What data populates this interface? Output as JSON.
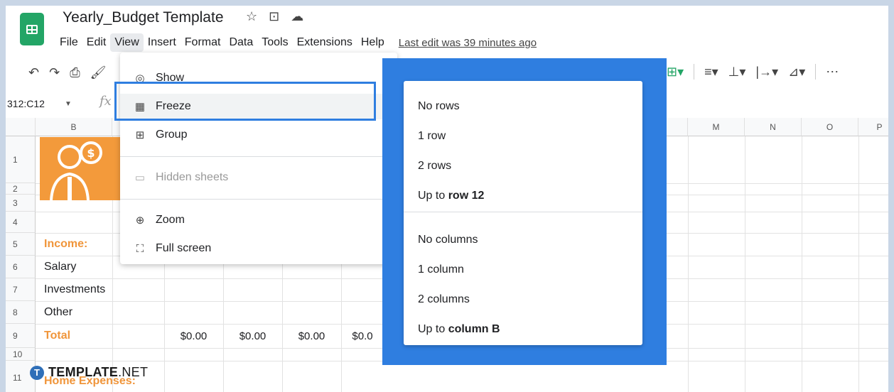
{
  "app": {
    "doc_title": "Yearly_Budget Template",
    "last_edit": "Last edit was 39 minutes ago",
    "icons": [
      "star-icon",
      "move-to-folder-icon",
      "cloud-status-icon"
    ]
  },
  "menubar": {
    "items": [
      "File",
      "Edit",
      "View",
      "Insert",
      "Format",
      "Data",
      "Tools",
      "Extensions",
      "Help"
    ],
    "active": "View"
  },
  "formula_bar": {
    "name_box": "312:C12",
    "fx": "fx"
  },
  "grid": {
    "columns": [
      "B",
      "M",
      "N",
      "O",
      "P"
    ],
    "rows": [
      "1",
      "2",
      "3",
      "4",
      "5",
      "6",
      "7",
      "8",
      "9",
      "10",
      "11"
    ],
    "labels": {
      "income": "Income:",
      "salary": "Salary",
      "investments": "Investments",
      "other": "Other",
      "total": "Total",
      "home_expenses": "Home Expenses:"
    },
    "total_values": [
      "$0.00",
      "$0.00",
      "$0.00",
      "$0.0"
    ],
    "partial_values": [
      "$0.00",
      "$0.00",
      "$0.00"
    ]
  },
  "view_menu": {
    "items": [
      {
        "label": "Show",
        "icon": "eye-icon",
        "submenu": true,
        "disabled": false
      },
      {
        "label": "Freeze",
        "icon": "freeze-grid-icon",
        "submenu": true,
        "disabled": false
      },
      {
        "label": "Group",
        "icon": "group-plus-icon",
        "submenu": true,
        "disabled": false
      },
      {
        "label": "Hidden sheets",
        "icon": "hidden-sheet-icon",
        "submenu": true,
        "disabled": true
      },
      {
        "label": "Zoom",
        "icon": "zoom-icon",
        "submenu": true,
        "disabled": false
      },
      {
        "label": "Full screen",
        "icon": "full-screen-icon",
        "submenu": false,
        "disabled": false
      }
    ]
  },
  "freeze_menu": {
    "rows": {
      "no_rows": "No rows",
      "one_row": "1 row",
      "two_rows": "2 rows",
      "up_to_prefix": "Up to ",
      "up_to_bold": "row 12"
    },
    "columns": {
      "no_columns": "No columns",
      "one_column": "1 column",
      "two_columns": "2 columns",
      "up_to_prefix": "Up to ",
      "up_to_bold": "column B"
    }
  },
  "watermark": {
    "badge": "T",
    "brand": "TEMPLATE",
    "suffix": ".NET"
  },
  "colors": {
    "accent_blue": "#2f7ee0",
    "orange": "#f0953a",
    "sheets_green": "#23a566"
  }
}
